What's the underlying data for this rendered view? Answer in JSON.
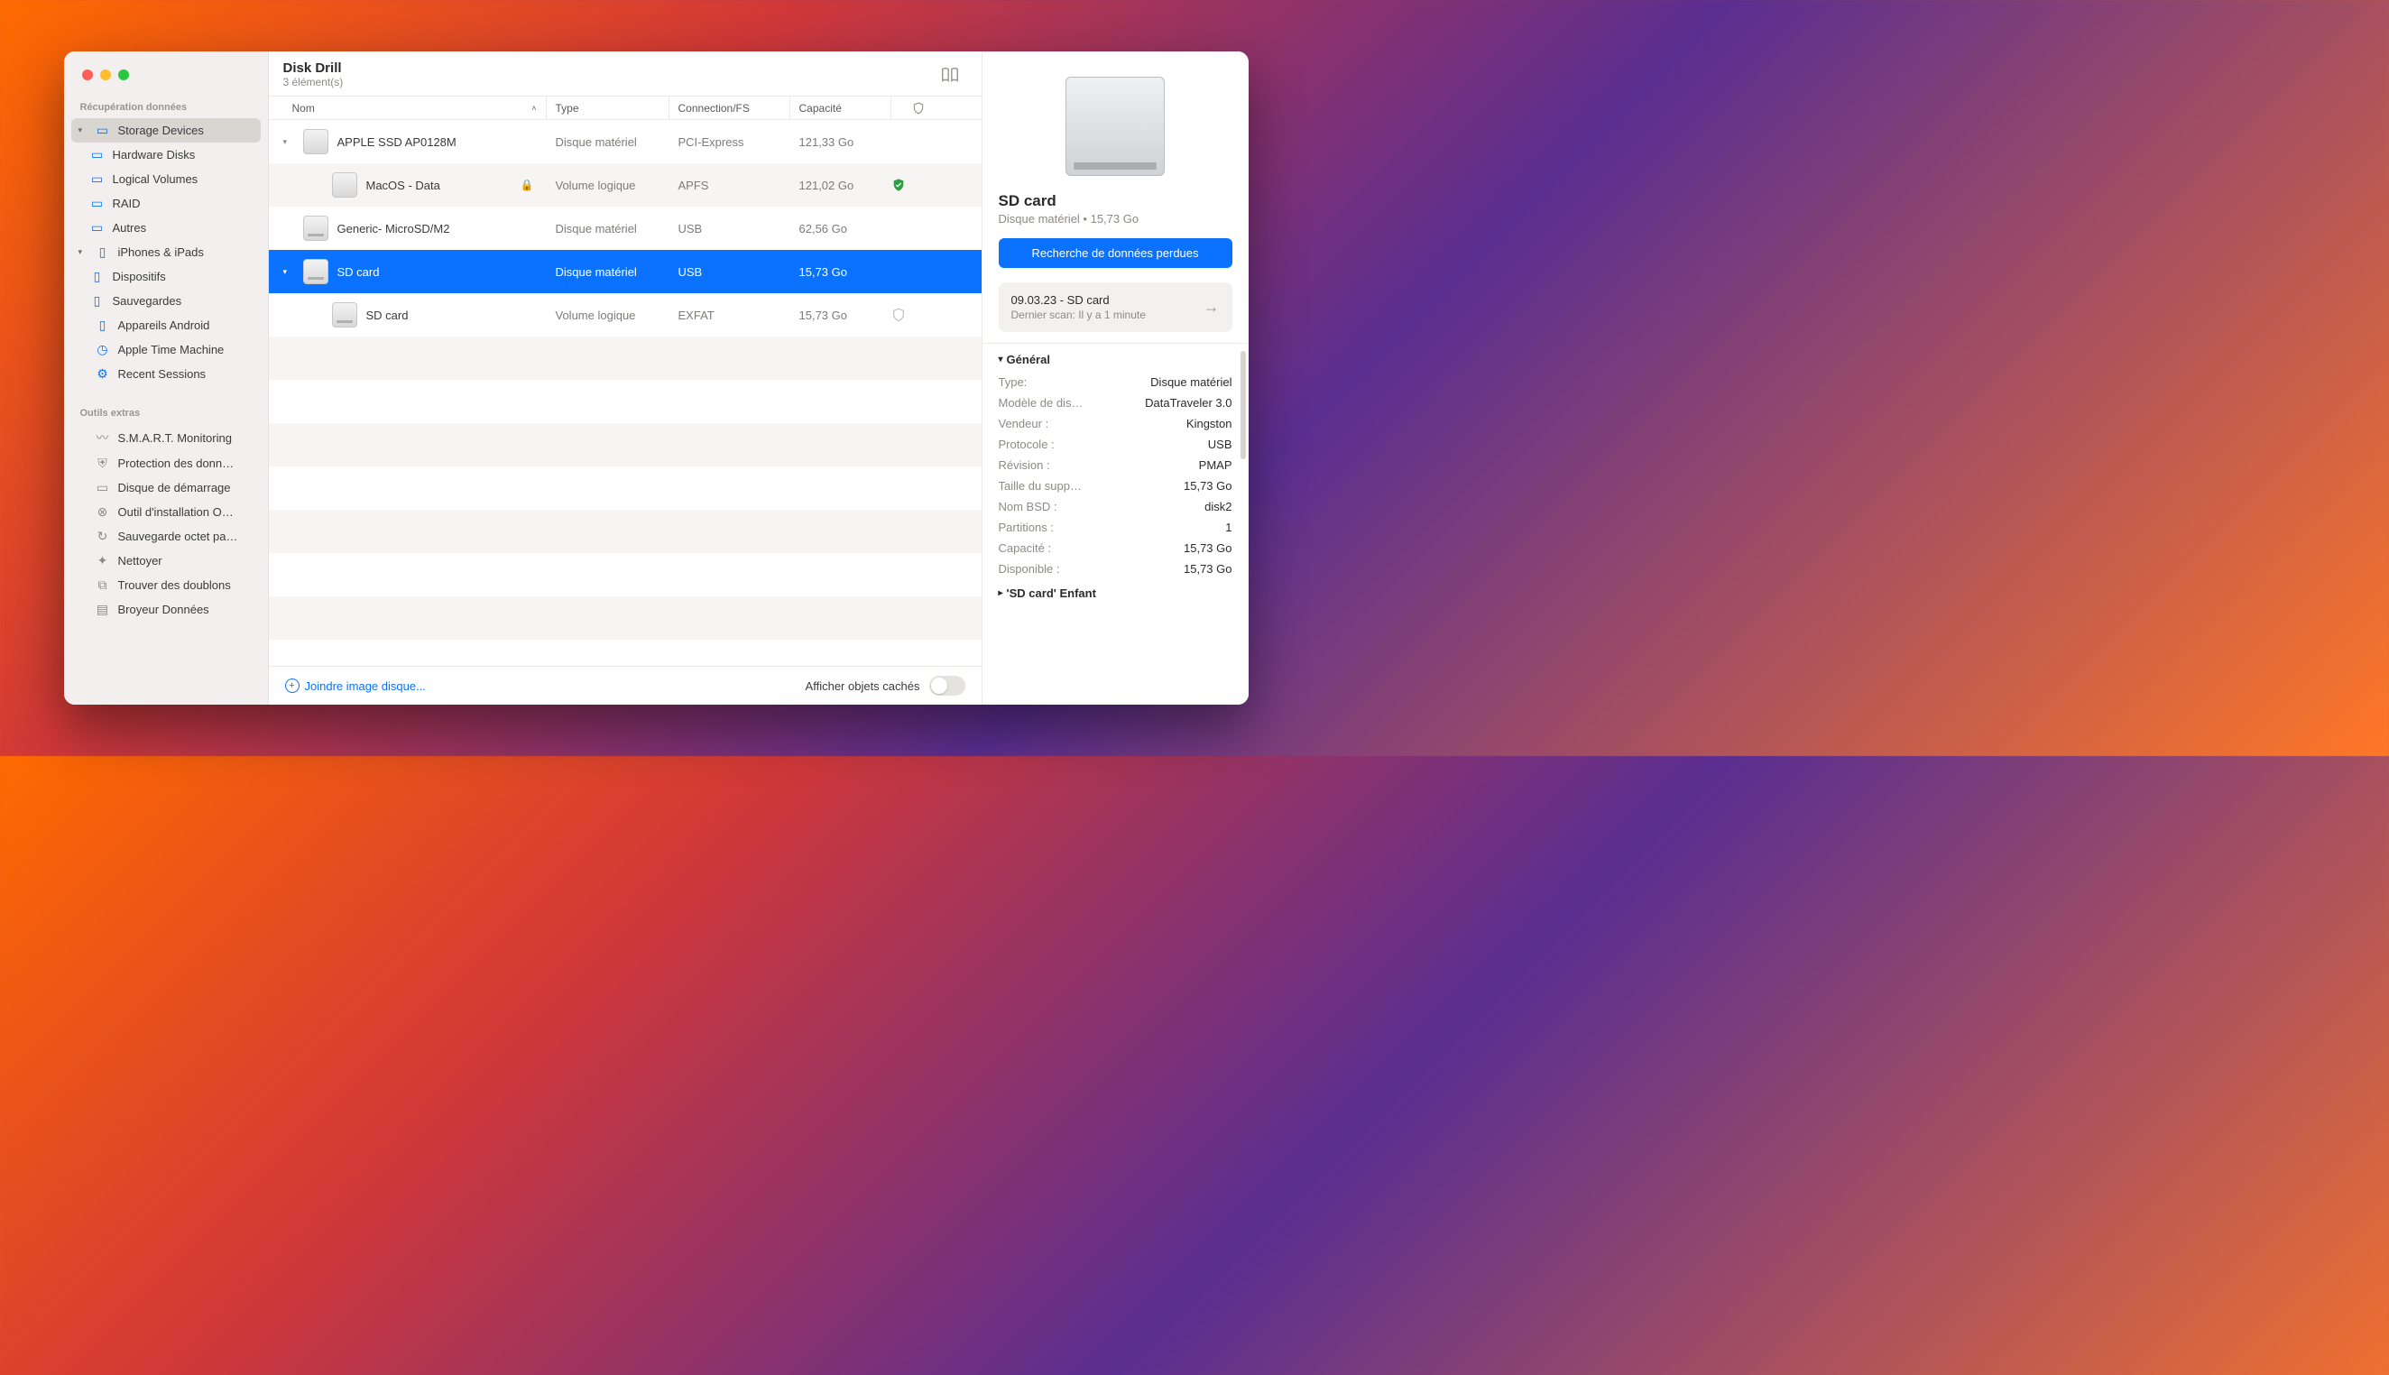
{
  "window": {
    "title": "Disk Drill",
    "subtitle": "3 élément(s)"
  },
  "sidebar": {
    "section1_header": "Récupération données",
    "items1": [
      {
        "label": "Storage Devices",
        "icon": "drive-icon"
      },
      {
        "label": "Hardware Disks",
        "icon": "drive-icon"
      },
      {
        "label": "Logical Volumes",
        "icon": "drive-icon"
      },
      {
        "label": "RAID",
        "icon": "drive-icon"
      },
      {
        "label": "Autres",
        "icon": "drive-icon"
      },
      {
        "label": "iPhones & iPads",
        "icon": "phone-icon"
      },
      {
        "label": "Dispositifs",
        "icon": "phone-icon"
      },
      {
        "label": "Sauvegardes",
        "icon": "phone-icon"
      },
      {
        "label": "Appareils Android",
        "icon": "phone-icon"
      },
      {
        "label": "Apple Time Machine",
        "icon": "timemachine-icon"
      },
      {
        "label": "Recent Sessions",
        "icon": "gear-icon"
      }
    ],
    "section2_header": "Outils extras",
    "items2": [
      {
        "label": "S.M.A.R.T. Monitoring",
        "icon": "pulse-icon"
      },
      {
        "label": "Protection des donn…",
        "icon": "shield-icon"
      },
      {
        "label": "Disque de démarrage",
        "icon": "drive-icon"
      },
      {
        "label": "Outil d'installation O…",
        "icon": "x-circle-icon"
      },
      {
        "label": "Sauvegarde octet pa…",
        "icon": "clock-icon"
      },
      {
        "label": "Nettoyer",
        "icon": "sparkle-icon"
      },
      {
        "label": "Trouver des doublons",
        "icon": "copy-icon"
      },
      {
        "label": "Broyeur Données",
        "icon": "shred-icon"
      }
    ]
  },
  "table": {
    "headers": {
      "nom": "Nom",
      "type": "Type",
      "conn": "Connection/FS",
      "cap": "Capacité"
    },
    "rows": [
      {
        "indent": 0,
        "chev": true,
        "name": "APPLE SSD AP0128M",
        "type": "Disque matériel",
        "conn": "PCI-Express",
        "cap": "121,33 Go",
        "lock": false,
        "shield": ""
      },
      {
        "indent": 1,
        "chev": false,
        "name": "MacOS - Data",
        "type": "Volume logique",
        "conn": "APFS",
        "cap": "121,02 Go",
        "lock": true,
        "shield": "green"
      },
      {
        "indent": 0,
        "chev": false,
        "name": "Generic- MicroSD/M2",
        "type": "Disque matériel",
        "conn": "USB",
        "cap": "62,56 Go",
        "lock": false,
        "shield": ""
      },
      {
        "indent": 0,
        "chev": true,
        "name": "SD card",
        "type": "Disque matériel",
        "conn": "USB",
        "cap": "15,73 Go",
        "lock": false,
        "shield": "",
        "selected": true
      },
      {
        "indent": 1,
        "chev": false,
        "name": "SD card",
        "type": "Volume logique",
        "conn": "EXFAT",
        "cap": "15,73 Go",
        "lock": false,
        "shield": "gray"
      }
    ]
  },
  "bottom": {
    "add_link": "Joindre image disque...",
    "hidden_label": "Afficher objets cachés"
  },
  "detail": {
    "title": "SD card",
    "subtitle": "Disque matériel • 15,73 Go",
    "primary_btn": "Recherche de données perdues",
    "scan_title": "09.03.23 - SD card",
    "scan_sub": "Dernier scan: Il y a 1 minute",
    "general_header": "Général",
    "kv": [
      {
        "k": "Type:",
        "v": "Disque matériel"
      },
      {
        "k": "Modèle de dis…",
        "v": "DataTraveler 3.0"
      },
      {
        "k": "Vendeur :",
        "v": "Kingston"
      },
      {
        "k": "Protocole :",
        "v": "USB"
      },
      {
        "k": "Révision :",
        "v": "PMAP"
      },
      {
        "k": "Taille du supp…",
        "v": "15,73 Go"
      },
      {
        "k": "Nom BSD :",
        "v": "disk2"
      },
      {
        "k": "Partitions :",
        "v": "1"
      },
      {
        "k": "Capacité :",
        "v": "15,73 Go"
      },
      {
        "k": "Disponible :",
        "v": "15,73 Go"
      }
    ],
    "child_header": "'SD card' Enfant"
  }
}
